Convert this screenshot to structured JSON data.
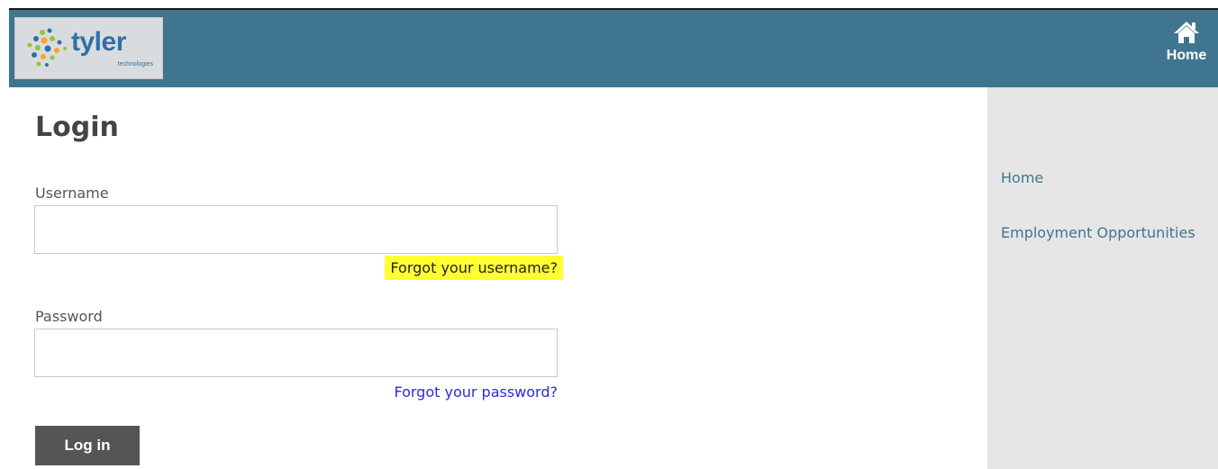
{
  "header": {
    "logo": {
      "word": "tyler",
      "sub": "technologies"
    },
    "home_button": {
      "label": "Home",
      "icon": "home-icon"
    },
    "colors": {
      "bar": "#3f758f",
      "logo_blue": "#2f6fa7"
    }
  },
  "login": {
    "title": "Login",
    "username": {
      "label": "Username",
      "value": "",
      "placeholder": ""
    },
    "forgot_username": "Forgot your username?",
    "password": {
      "label": "Password",
      "value": "",
      "placeholder": ""
    },
    "forgot_password": "Forgot your password?",
    "submit_label": "Log in"
  },
  "sidebar": {
    "items": [
      {
        "label": "Home"
      },
      {
        "label": "Employment Opportunities"
      }
    ]
  },
  "colors": {
    "highlight": "#ffff33",
    "link": "#2a2ae0",
    "sidebar_link": "#3f758f",
    "sidebar_bg": "#e6e6e6",
    "button_bg": "#555555"
  }
}
